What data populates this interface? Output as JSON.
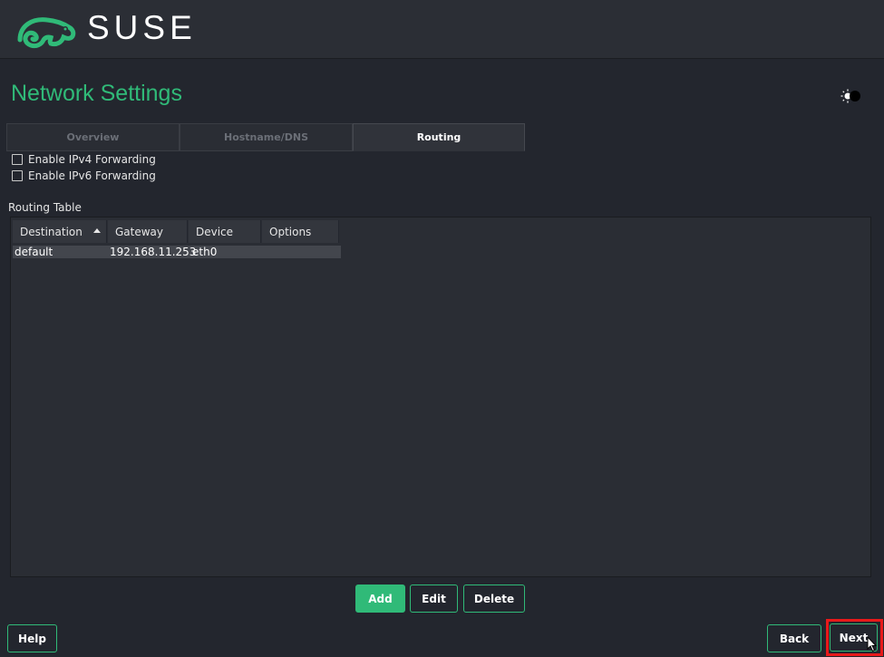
{
  "header": {
    "brand": "SUSE",
    "logo_icon": "suse-chameleon-icon",
    "brand_color": "#30ba78"
  },
  "page": {
    "title": "Network Settings",
    "theme_toggle_icon": "theme-toggle-icon"
  },
  "tabs": [
    {
      "label": "Overview",
      "active": false
    },
    {
      "label": "Hostname/DNS",
      "active": false
    },
    {
      "label": "Routing",
      "active": true
    }
  ],
  "forwarding": {
    "ipv4_label": "Enable IPv4 Forwarding",
    "ipv4_checked": false,
    "ipv6_label": "Enable IPv6 Forwarding",
    "ipv6_checked": false
  },
  "routing_table": {
    "label": "Routing Table",
    "columns": [
      "Destination",
      "Gateway",
      "Device",
      "Options"
    ],
    "sort_column": "Destination",
    "sort_direction": "ascending",
    "rows": [
      {
        "destination": "default",
        "gateway": "192.168.11.253",
        "device": "eth0",
        "options": ""
      }
    ]
  },
  "actions": {
    "add": "Add",
    "edit": "Edit",
    "delete": "Delete"
  },
  "footer": {
    "help": "Help",
    "back": "Back",
    "next": "Next"
  }
}
